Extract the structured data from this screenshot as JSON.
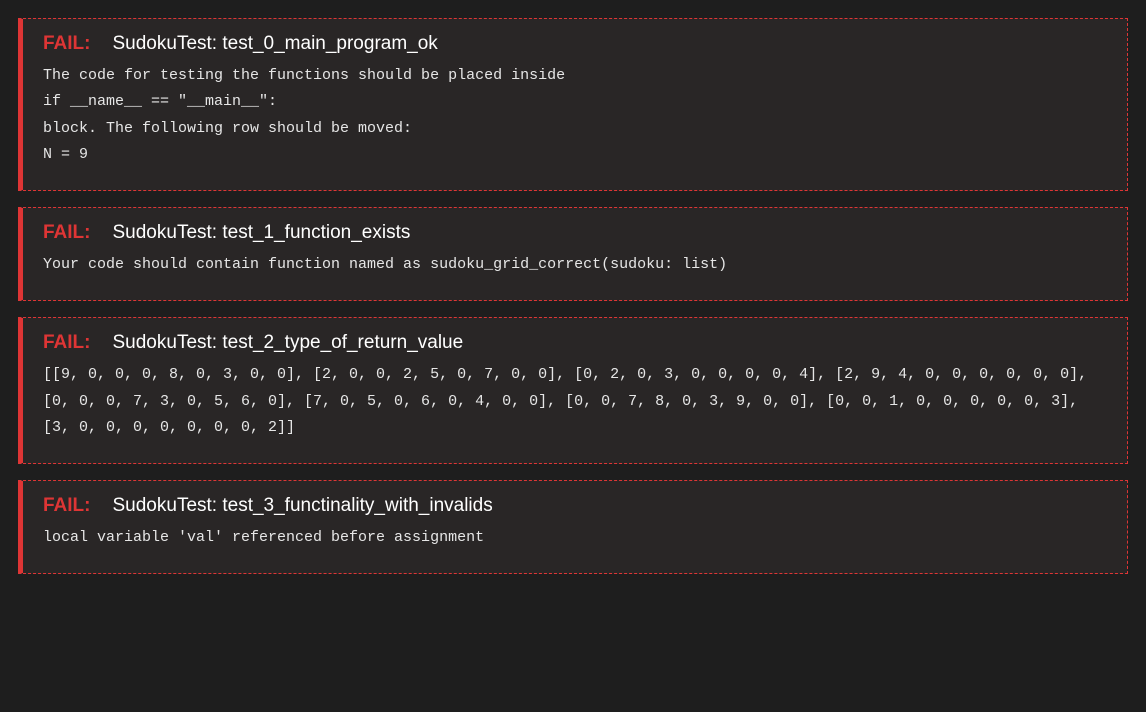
{
  "tests": [
    {
      "status": "FAIL:",
      "name": "SudokuTest: test_0_main_program_ok",
      "message": "The code for testing the functions should be placed inside\nif __name__ == \"__main__\":\nblock. The following row should be moved:\nN = 9"
    },
    {
      "status": "FAIL:",
      "name": "SudokuTest: test_1_function_exists",
      "message": "Your code should contain function named as sudoku_grid_correct(sudoku: list)"
    },
    {
      "status": "FAIL:",
      "name": "SudokuTest: test_2_type_of_return_value",
      "message": "[[9, 0, 0, 0, 8, 0, 3, 0, 0], [2, 0, 0, 2, 5, 0, 7, 0, 0], [0, 2, 0, 3, 0, 0, 0, 0, 4], [2, 9, 4, 0, 0, 0, 0, 0, 0], [0, 0, 0, 7, 3, 0, 5, 6, 0], [7, 0, 5, 0, 6, 0, 4, 0, 0], [0, 0, 7, 8, 0, 3, 9, 0, 0], [0, 0, 1, 0, 0, 0, 0, 0, 3], [3, 0, 0, 0, 0, 0, 0, 0, 2]]"
    },
    {
      "status": "FAIL:",
      "name": "SudokuTest: test_3_functinality_with_invalids",
      "message": "local variable 'val' referenced before assignment"
    }
  ]
}
